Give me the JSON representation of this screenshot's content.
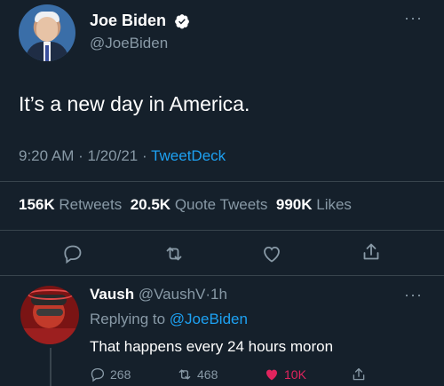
{
  "tweet": {
    "author_name": "Joe Biden",
    "author_handle": "@JoeBiden",
    "text": "It’s a new day in America.",
    "time": "9:20 AM",
    "date": "1/20/21",
    "separator": "·",
    "client": "TweetDeck",
    "stats": {
      "retweets": "156K",
      "retweets_label": "Retweets",
      "quote_tweets": "20.5K",
      "quote_tweets_label": "Quote Tweets",
      "likes": "990K",
      "likes_label": "Likes"
    },
    "actions": [
      "reply-icon",
      "retweet-icon",
      "like-icon",
      "share-icon"
    ]
  },
  "reply": {
    "author_name": "Vaush",
    "author_handle": "@VaushV",
    "separator": "·",
    "age": "1h",
    "replying_prefix": "Replying to",
    "replying_to": "@JoeBiden",
    "text": "That happens every 24 hours moron",
    "counts": {
      "replies": "268",
      "retweets": "468",
      "likes": "10K"
    }
  },
  "colors": {
    "background": "#15202b",
    "text": "#ffffff",
    "muted": "#8899a6",
    "accent": "#1da1f2",
    "like": "#e0245e",
    "divider": "#38444d"
  }
}
